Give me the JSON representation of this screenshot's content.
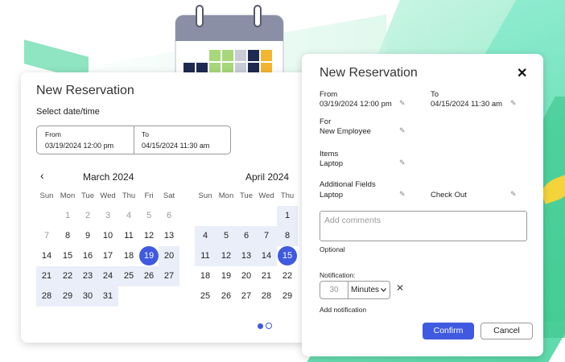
{
  "calendar_card": {
    "title": "New Reservation",
    "subtitle": "Select date/time",
    "from_label": "From",
    "from_value": "03/19/2024 12:00 pm",
    "to_label": "To",
    "to_value": "04/15/2024 11:30 am",
    "prev_icon": "‹",
    "weekdays": [
      "Sun",
      "Mon",
      "Tue",
      "Wed",
      "Thu",
      "Fri",
      "Sat"
    ],
    "months": [
      {
        "name": "March 2024",
        "rows": [
          [
            "",
            "",
            "1",
            "2",
            "3",
            "4",
            "5",
            "6"
          ],
          [
            "7",
            "8",
            "9",
            "10",
            "11",
            "12",
            "13"
          ],
          [
            "14",
            "15",
            "16",
            "17",
            "18",
            "19",
            "20"
          ],
          [
            "21",
            "22",
            "23",
            "24",
            "25",
            "26",
            "27"
          ],
          [
            "28",
            "29",
            "30",
            "31"
          ]
        ]
      },
      {
        "name": "April 2024",
        "rows": [
          [
            "",
            "",
            "",
            "",
            "",
            "",
            "1"
          ],
          [
            "4",
            "5",
            "6",
            "7",
            "8"
          ],
          [
            "11",
            "12",
            "13",
            "14",
            "15"
          ],
          [
            "18",
            "19",
            "20",
            "21",
            "22"
          ],
          [
            "25",
            "26",
            "27",
            "28",
            "29"
          ]
        ]
      }
    ]
  },
  "reservation_card": {
    "title": "New Reservation",
    "from_label": "From",
    "from_value": "03/19/2024 12:00 pm",
    "to_label": "To",
    "to_value": "04/15/2024 11:30 am",
    "for_label": "For",
    "for_value": "New Employee",
    "items_label": "Items",
    "items_value": "Laptop",
    "additional_label": "Additional Fields",
    "additional_value": "Laptop",
    "checkout_value": "Check Out",
    "comments_placeholder": "Add comments",
    "optional_text": "Optional",
    "notification_label": "Notification:",
    "notification_value": "30",
    "notification_unit": "Minutes",
    "add_notification": "Add notification",
    "confirm_label": "Confirm",
    "cancel_label": "Cancel",
    "close_icon": "✕",
    "remove_icon": "✕",
    "edit_icon": "✎"
  },
  "colors": {
    "accent": "#3f5ae0",
    "range": "#e9eef9",
    "bg_green": "#34d399"
  }
}
